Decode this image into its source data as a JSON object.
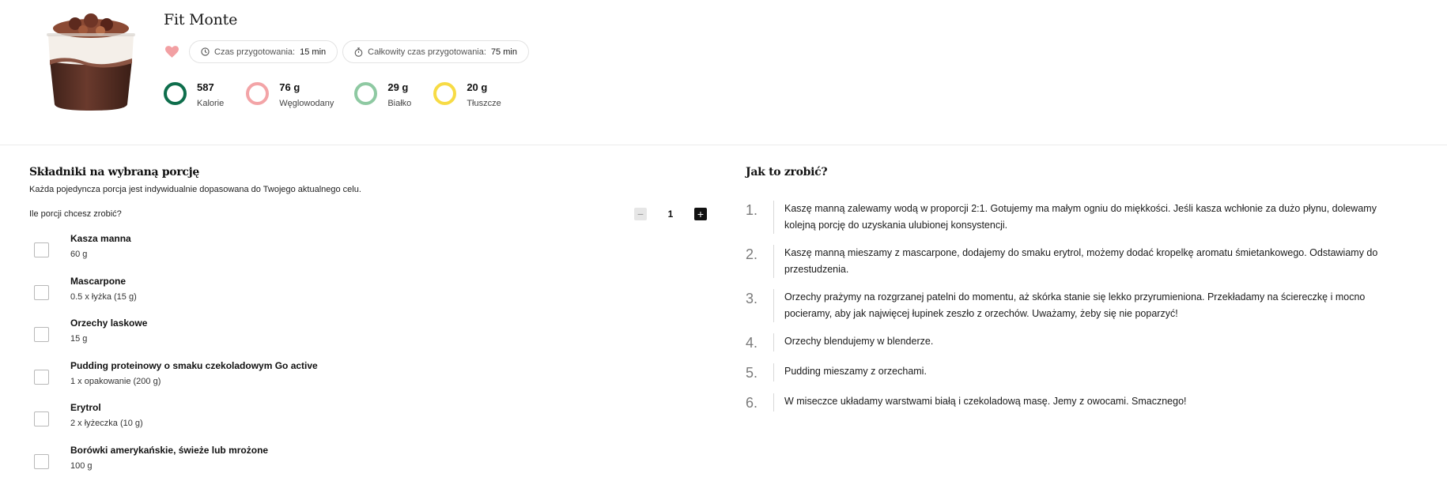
{
  "recipe": {
    "title": "Fit Monte",
    "image_alt": "dessert-cup-image"
  },
  "meta": {
    "prep_label": "Czas przygotowania:",
    "prep_value": "15 min",
    "total_label": "Całkowity czas przygotowania:",
    "total_value": "75 min",
    "favorite_color": "#f2a0a3"
  },
  "macros": [
    {
      "value": "587",
      "label": "Kalorie",
      "color": "#0e6e4c"
    },
    {
      "value": "76 g",
      "label": "Węglowodany",
      "color": "#f3a4a7"
    },
    {
      "value": "29 g",
      "label": "Białko",
      "color": "#8ec9a2"
    },
    {
      "value": "20 g",
      "label": "Tłuszcze",
      "color": "#f7db45"
    }
  ],
  "ingredients": {
    "title": "Składniki na wybraną porcję",
    "subtitle": "Każda pojedyncza porcja jest indywidualnie dopasowana do Twojego aktualnego celu.",
    "portion_label": "Ile porcji chcesz zrobić?",
    "portion_count": "1",
    "minus_symbol": "−",
    "plus_symbol": "+",
    "items": [
      {
        "name": "Kasza manna",
        "qty": "60 g"
      },
      {
        "name": "Mascarpone",
        "qty": "0.5 x łyżka (15 g)"
      },
      {
        "name": "Orzechy laskowe",
        "qty": "15 g"
      },
      {
        "name": "Pudding proteinowy o smaku czekoladowym Go active",
        "qty": "1 x opakowanie (200 g)"
      },
      {
        "name": "Erytrol",
        "qty": "2 x łyżeczka (10 g)"
      },
      {
        "name": "Borówki amerykańskie, świeże lub mrożone",
        "qty": "100 g"
      }
    ]
  },
  "steps": {
    "title": "Jak to zrobić?",
    "items": [
      {
        "num": "1.",
        "text": "Kaszę manną zalewamy wodą w proporcji 2:1. Gotujemy ma małym ogniu do miękkości. Jeśli kasza wchłonie za dużo płynu, dolewamy kolejną porcję do uzyskania ulubionej konsystencji."
      },
      {
        "num": "2.",
        "text": "Kaszę manną mieszamy z mascarpone, dodajemy do smaku erytrol, możemy dodać kropelkę aromatu śmietankowego. Odstawiamy do przestudzenia."
      },
      {
        "num": "3.",
        "text": "Orzechy prażymy na rozgrzanej patelni do momentu, aż skórka stanie się lekko przyrumieniona. Przekładamy na ściereczkę i mocno pocieramy, aby jak najwięcej łupinek zeszło z orzechów. Uważamy, żeby się nie poparzyć!"
      },
      {
        "num": "4.",
        "text": "Orzechy blendujemy w blenderze."
      },
      {
        "num": "5.",
        "text": "Pudding mieszamy z orzechami."
      },
      {
        "num": "6.",
        "text": "W miseczce układamy warstwami białą i czekoladową masę. Jemy z owocami. Smacznego!"
      }
    ]
  }
}
